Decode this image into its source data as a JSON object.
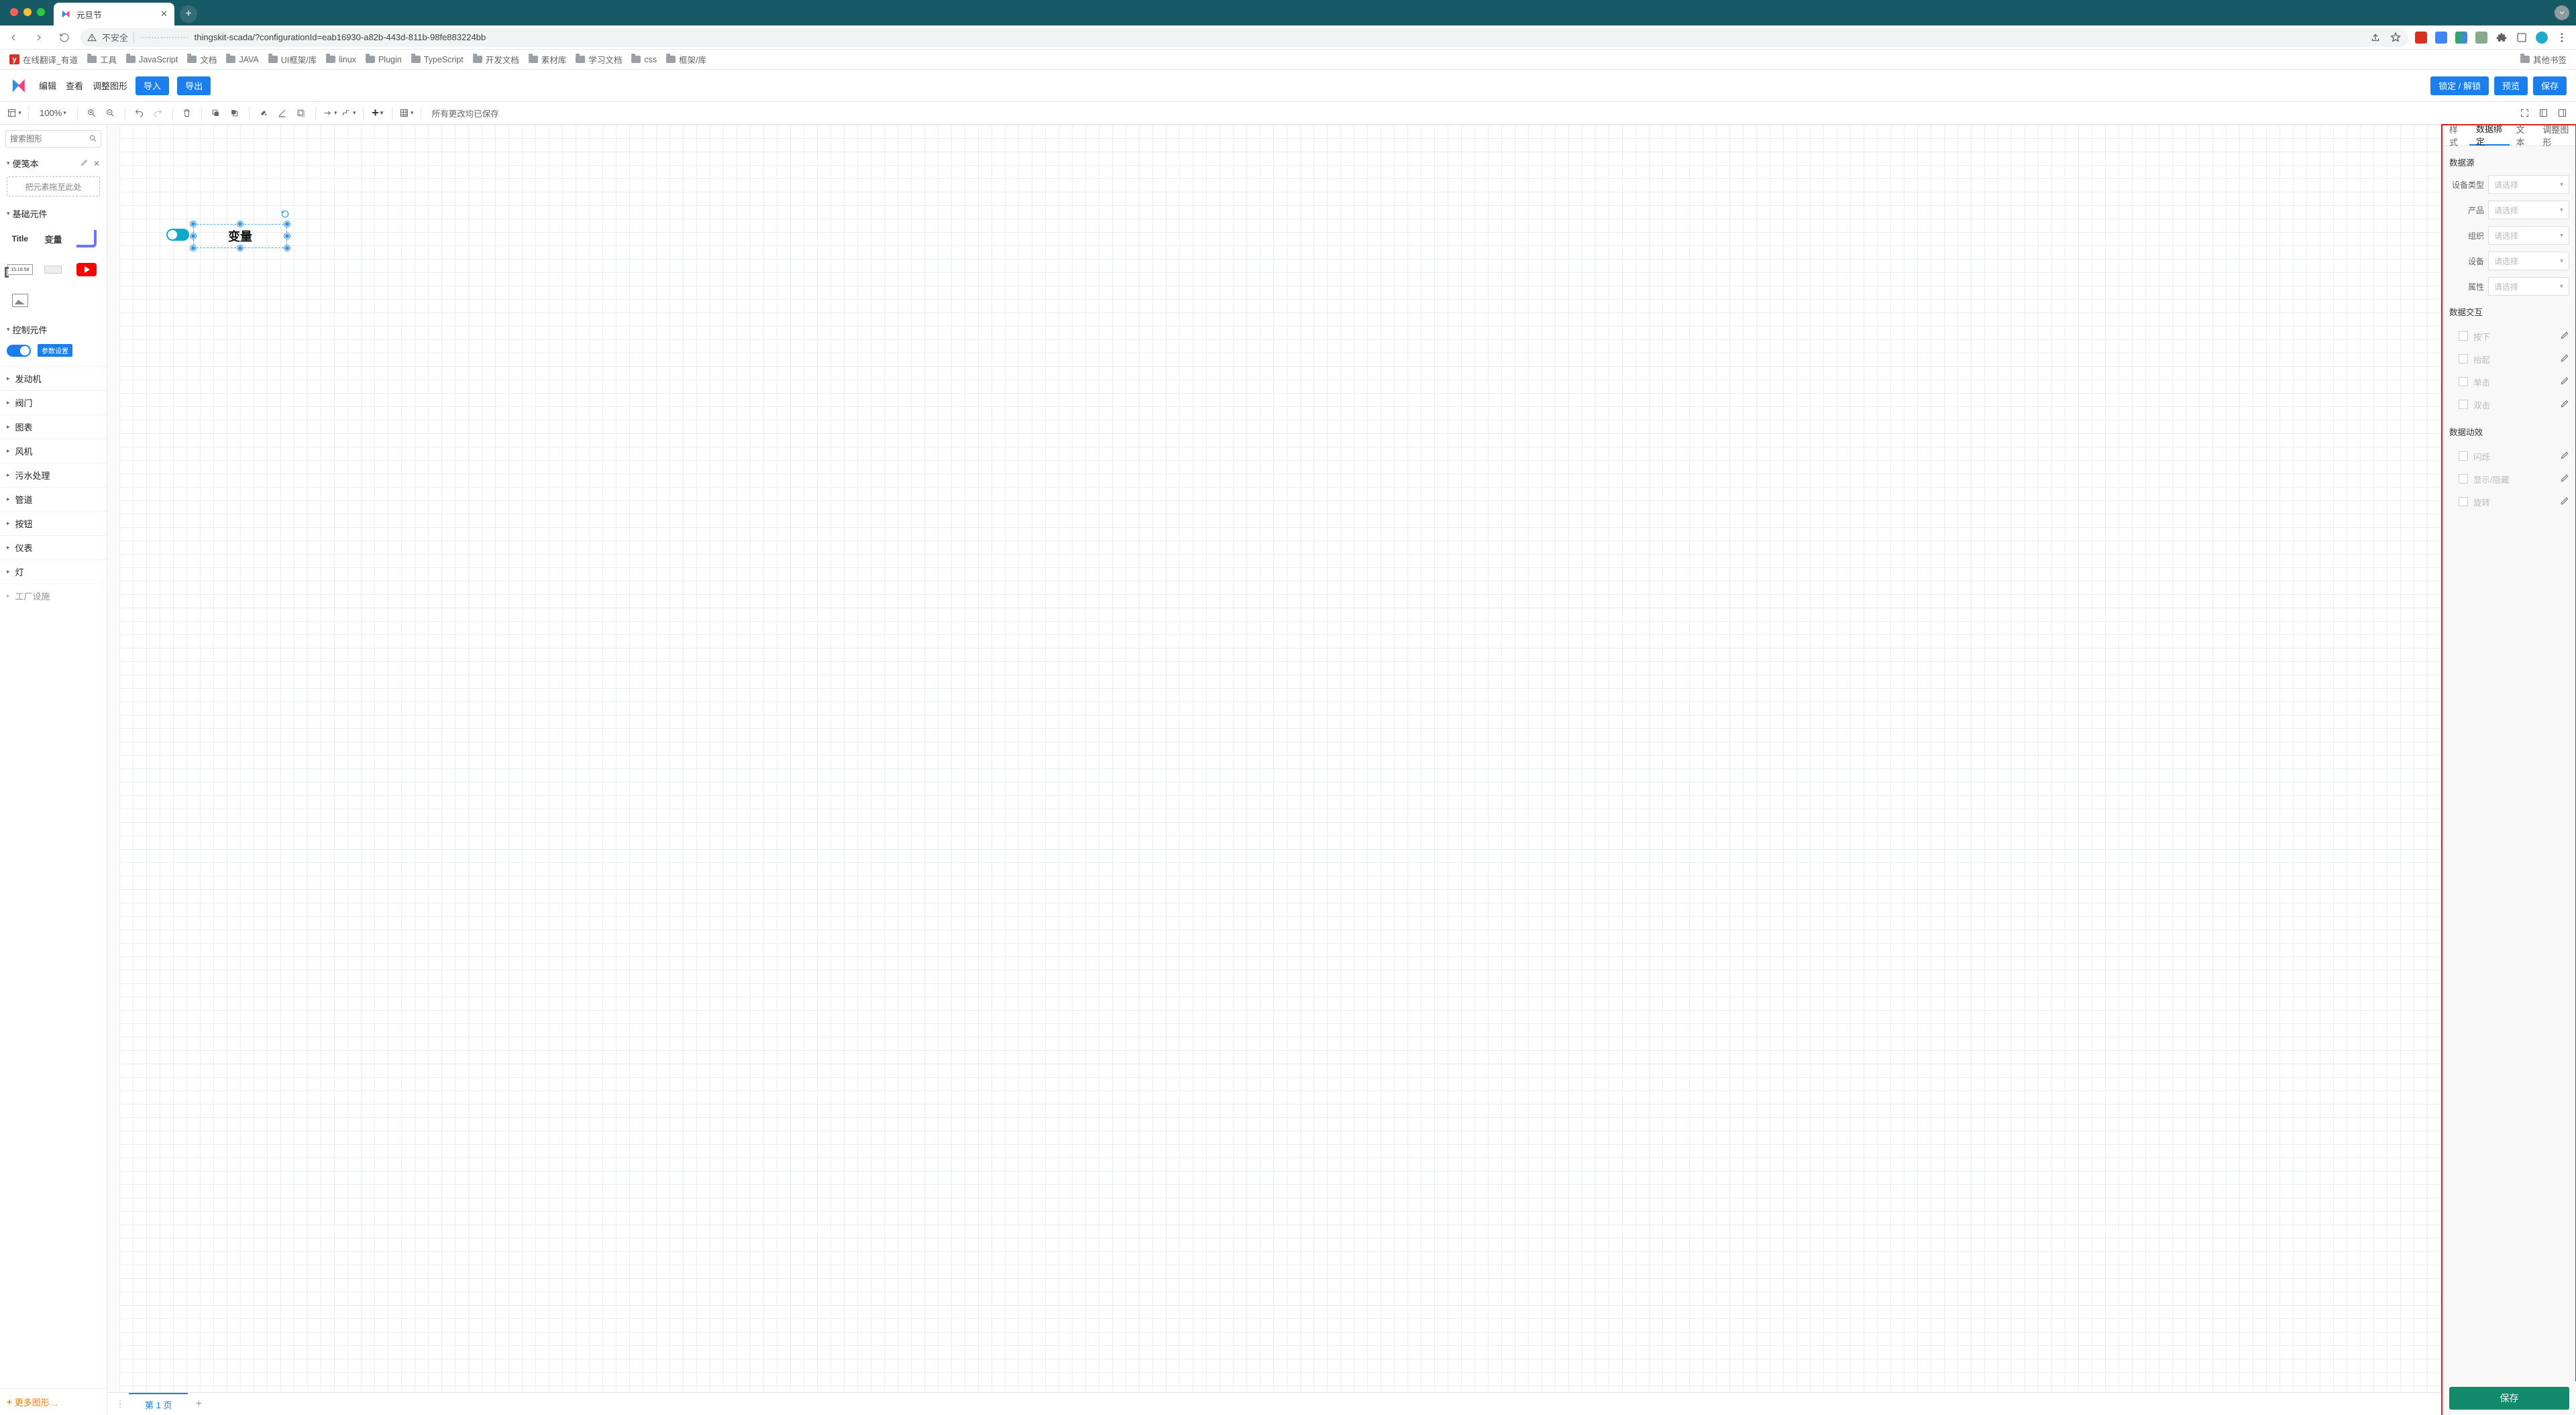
{
  "browser": {
    "tab_title": "元旦节",
    "security_label": "不安全",
    "url_host_hidden": "·················",
    "url_path": "thingskit-scada/?configurationId=eab16930-a82b-443d-811b-98fe883224bb",
    "bookmarks": [
      "在线翻译_有道",
      "工具",
      "JavaScript",
      "文档",
      "JAVA",
      "UI框架/库",
      "linux",
      "Plugin",
      "TypeScript",
      "开发文档",
      "素材库",
      "学习文档",
      "css",
      "框架/库"
    ],
    "bookmarks_right": "其他书签"
  },
  "app": {
    "menu": [
      "编辑",
      "查看",
      "调整图形"
    ],
    "import_label": "导入",
    "export_label": "导出",
    "lock_label": "锁定 / 解锁",
    "preview_label": "预览",
    "save_label": "保存",
    "zoom": "100%",
    "saved_status": "所有更改均已保存"
  },
  "left": {
    "search_placeholder": "搜索图形",
    "scratchpad_title": "便笺本",
    "scratch_drop_hint": "把元素拖至此处",
    "section_basic": "基础元件",
    "section_control": "控制元件",
    "param_btn": "参数设置",
    "shape_title": "Title",
    "shape_var": "变量",
    "shape_time": "15:16:58",
    "categories": [
      "发动机",
      "阀门",
      "图表",
      "风机",
      "污水处理",
      "管道",
      "按钮",
      "仪表",
      "灯",
      "工厂设施"
    ],
    "more_shapes": "更多图形…"
  },
  "canvas": {
    "selected_text": "变量",
    "page_tab": "第 1 页"
  },
  "right": {
    "tabs": [
      "样式",
      "数据绑定",
      "文本",
      "调整图形"
    ],
    "active_tab_index": 1,
    "datasource_title": "数据源",
    "fields": {
      "device_type": {
        "label": "设备类型",
        "placeholder": "请选择"
      },
      "product": {
        "label": "产品",
        "placeholder": "请选择"
      },
      "org": {
        "label": "组织",
        "placeholder": "请选择"
      },
      "device": {
        "label": "设备",
        "placeholder": "请选择"
      },
      "attr": {
        "label": "属性",
        "placeholder": "请选择"
      }
    },
    "interaction_title": "数据交互",
    "interactions": [
      "按下",
      "抬起",
      "单击",
      "双击"
    ],
    "animation_title": "数据动效",
    "animations": [
      "闪烁",
      "显示/隐藏",
      "旋转"
    ],
    "save_label": "保存"
  }
}
